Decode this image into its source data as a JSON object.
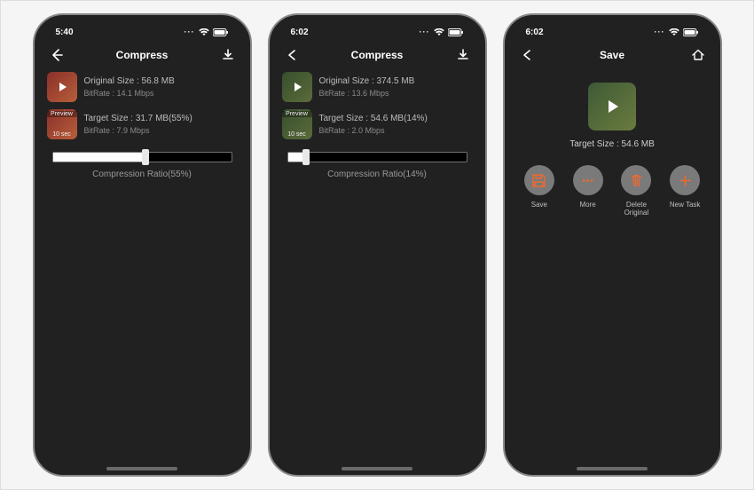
{
  "screens": [
    {
      "time": "5:40",
      "title": "Compress",
      "rightIcon": "download",
      "rows": [
        {
          "thumbClass": "red",
          "showPlay": true,
          "line1": "Original Size : 56.8 MB",
          "line2": "BitRate : 14.1 Mbps"
        },
        {
          "thumbClass": "red",
          "badgePreview": "Preview",
          "badgeSec": "10 sec",
          "line1": "Target Size : 31.7 MB(55%)",
          "line2": "BitRate : 7.9 Mbps"
        }
      ],
      "slider": {
        "fillPct": 52,
        "knobPct": 52
      },
      "ratio": "Compression Ratio(55%)"
    },
    {
      "time": "6:02",
      "title": "Compress",
      "rightIcon": "download",
      "rows": [
        {
          "thumbClass": "green",
          "showPlay": true,
          "line1": "Original Size : 374.5 MB",
          "line2": "BitRate : 13.6 Mbps"
        },
        {
          "thumbClass": "green",
          "badgePreview": "Preview",
          "badgeSec": "10 sec",
          "line1": "Target Size : 54.6 MB(14%)",
          "line2": "BitRate : 2.0 Mbps"
        }
      ],
      "slider": {
        "fillPct": 10,
        "knobPct": 10
      },
      "ratio": "Compression Ratio(14%)"
    },
    {
      "time": "6:02",
      "title": "Save",
      "rightIcon": "home",
      "targetLine": "Target Size : 54.6 MB",
      "actions": [
        {
          "icon": "save",
          "label": "Save"
        },
        {
          "icon": "more",
          "label": "More"
        },
        {
          "icon": "trash",
          "label": "Delete Original"
        },
        {
          "icon": "plus",
          "label": "New Task"
        }
      ]
    }
  ],
  "accent": "#ef6a2e"
}
